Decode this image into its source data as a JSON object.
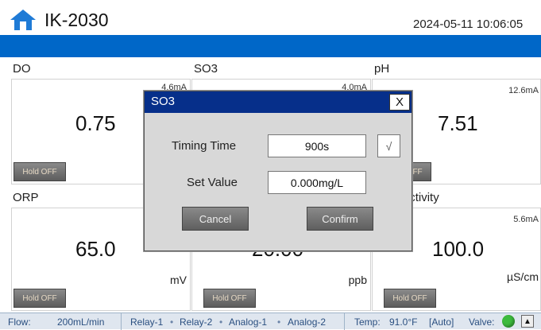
{
  "header": {
    "title": "IK-2030",
    "datetime": "2024-05-11 10:06:05",
    "home_icon": "home-icon"
  },
  "panels": {
    "do": {
      "label": "DO",
      "range": "4.6mA",
      "value": "0.75",
      "unit": "",
      "hold": "Hold OFF"
    },
    "so3": {
      "label": "SO3",
      "range": "4.0mA",
      "value": ""
    },
    "ph": {
      "label": "pH",
      "range": "12.6mA",
      "value": "7.51",
      "hold": "Hold OFF"
    },
    "orp": {
      "label": "ORP",
      "range": "",
      "value": "65.0",
      "unit": "mV",
      "hold": "Hold OFF"
    },
    "mid_bottom": {
      "value": "20.00",
      "unit": "ppb",
      "hold": "Hold OFF"
    },
    "conductivity": {
      "label": "Conductivity",
      "range": "5.6mA",
      "value": "100.0",
      "unit": "µS/cm",
      "hold": "Hold OFF"
    }
  },
  "dialog": {
    "title": "SO3",
    "close": "X",
    "timing_label": "Timing Time",
    "timing_value": "900s",
    "check_mark": "√",
    "set_label": "Set Value",
    "set_value": "0.000mg/L",
    "cancel": "Cancel",
    "confirm": "Confirm"
  },
  "status": {
    "flow_label": "Flow:",
    "flow_value": "200mL/min",
    "relay1": "Relay-1",
    "relay2": "Relay-2",
    "analog1": "Analog-1",
    "analog2": "Analog-2",
    "dot": "•",
    "temp_label": "Temp:",
    "temp_value": "91.0°F",
    "mode": "[Auto]",
    "valve_label": "Valve:",
    "valve_color": "#3dbb3d"
  },
  "colors": {
    "band": "#0067c8",
    "dialog_title": "#062f8a"
  }
}
